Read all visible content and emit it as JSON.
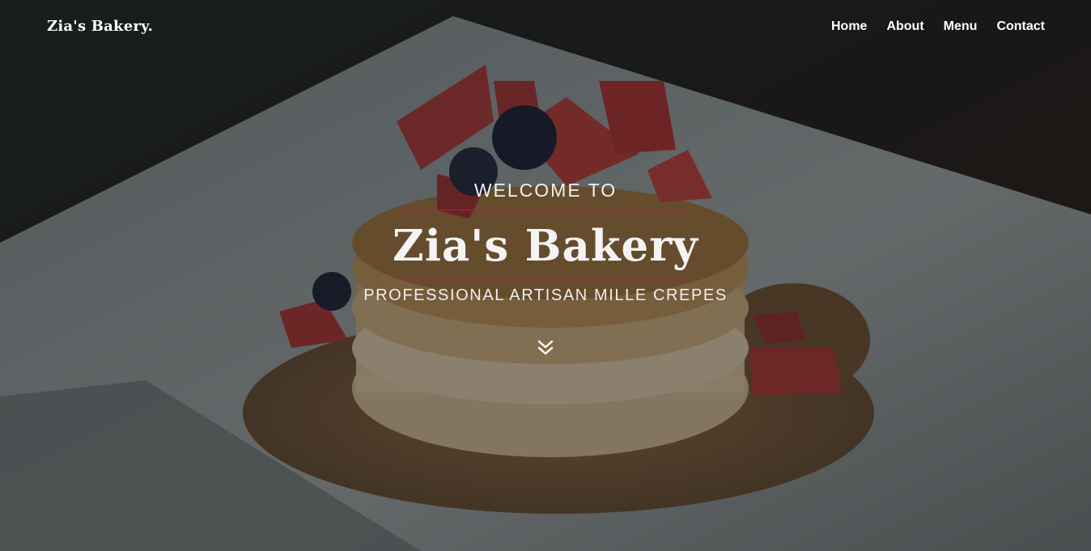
{
  "nav": {
    "brand": "Zia's Bakery.",
    "links": [
      {
        "label": "Home"
      },
      {
        "label": "About"
      },
      {
        "label": "Menu"
      },
      {
        "label": "Contact"
      }
    ]
  },
  "hero": {
    "welcome": "WELCOME TO",
    "title": "Zia's Bakery",
    "subtitle": "PROFESSIONAL ARTISAN MILLE CREPES",
    "scroll_icon": "double-chevron-down-icon",
    "background_image": "pancake stack with strawberries and blueberries on a white plate",
    "accent_color": "#c2185b"
  }
}
